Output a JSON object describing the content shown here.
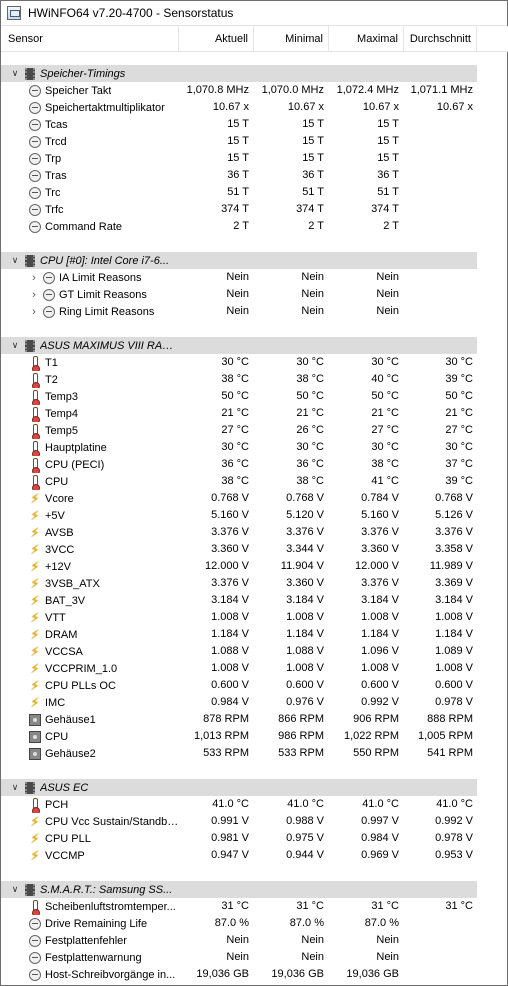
{
  "window": {
    "title": "HWiNFO64 v7.20-4700 - Sensorstatus"
  },
  "columns": {
    "sensor": "Sensor",
    "current": "Aktuell",
    "min": "Minimal",
    "max": "Maximal",
    "avg": "Durchschnitt"
  },
  "groups": [
    {
      "name": "Speicher-Timings",
      "rows": [
        {
          "icon": "clock",
          "label": "Speicher Takt",
          "cur": "1,070.8 MHz",
          "min": "1,070.0 MHz",
          "max": "1,072.4 MHz",
          "avg": "1,071.1 MHz"
        },
        {
          "icon": "clock",
          "label": "Speichertaktmultiplikator",
          "cur": "10.67 x",
          "min": "10.67 x",
          "max": "10.67 x",
          "avg": "10.67 x"
        },
        {
          "icon": "clock",
          "label": "Tcas",
          "cur": "15 T",
          "min": "15 T",
          "max": "15 T",
          "avg": ""
        },
        {
          "icon": "clock",
          "label": "Trcd",
          "cur": "15 T",
          "min": "15 T",
          "max": "15 T",
          "avg": ""
        },
        {
          "icon": "clock",
          "label": "Trp",
          "cur": "15 T",
          "min": "15 T",
          "max": "15 T",
          "avg": ""
        },
        {
          "icon": "clock",
          "label": "Tras",
          "cur": "36 T",
          "min": "36 T",
          "max": "36 T",
          "avg": ""
        },
        {
          "icon": "clock",
          "label": "Trc",
          "cur": "51 T",
          "min": "51 T",
          "max": "51 T",
          "avg": ""
        },
        {
          "icon": "clock",
          "label": "Trfc",
          "cur": "374 T",
          "min": "374 T",
          "max": "374 T",
          "avg": ""
        },
        {
          "icon": "clock",
          "label": "Command Rate",
          "cur": "2 T",
          "min": "2 T",
          "max": "2 T",
          "avg": ""
        }
      ]
    },
    {
      "name": "CPU [#0]: Intel Core i7-6...",
      "rows": [
        {
          "icon": "clock",
          "expandable": true,
          "label": "IA Limit Reasons",
          "cur": "Nein",
          "min": "Nein",
          "max": "Nein",
          "avg": ""
        },
        {
          "icon": "clock",
          "expandable": true,
          "label": "GT Limit Reasons",
          "cur": "Nein",
          "min": "Nein",
          "max": "Nein",
          "avg": ""
        },
        {
          "icon": "clock",
          "expandable": true,
          "label": "Ring Limit Reasons",
          "cur": "Nein",
          "min": "Nein",
          "max": "Nein",
          "avg": ""
        }
      ]
    },
    {
      "name": "ASUS MAXIMUS VIII RAN...",
      "rows": [
        {
          "icon": "therm",
          "label": "T1",
          "cur": "30 °C",
          "min": "30 °C",
          "max": "30 °C",
          "avg": "30 °C"
        },
        {
          "icon": "therm",
          "label": "T2",
          "cur": "38 °C",
          "min": "38 °C",
          "max": "40 °C",
          "avg": "39 °C"
        },
        {
          "icon": "therm",
          "label": "Temp3",
          "cur": "50 °C",
          "min": "50 °C",
          "max": "50 °C",
          "avg": "50 °C"
        },
        {
          "icon": "therm",
          "label": "Temp4",
          "cur": "21 °C",
          "min": "21 °C",
          "max": "21 °C",
          "avg": "21 °C"
        },
        {
          "icon": "therm",
          "label": "Temp5",
          "cur": "27 °C",
          "min": "26 °C",
          "max": "27 °C",
          "avg": "27 °C"
        },
        {
          "icon": "therm",
          "label": "Hauptplatine",
          "cur": "30 °C",
          "min": "30 °C",
          "max": "30 °C",
          "avg": "30 °C"
        },
        {
          "icon": "therm",
          "label": "CPU (PECI)",
          "cur": "36 °C",
          "min": "36 °C",
          "max": "38 °C",
          "avg": "37 °C"
        },
        {
          "icon": "therm",
          "label": "CPU",
          "cur": "38 °C",
          "min": "38 °C",
          "max": "41 °C",
          "avg": "39 °C"
        },
        {
          "icon": "volt",
          "label": "Vcore",
          "cur": "0.768 V",
          "min": "0.768 V",
          "max": "0.784 V",
          "avg": "0.768 V"
        },
        {
          "icon": "volt",
          "label": "+5V",
          "cur": "5.160 V",
          "min": "5.120 V",
          "max": "5.160 V",
          "avg": "5.126 V"
        },
        {
          "icon": "volt",
          "label": "AVSB",
          "cur": "3.376 V",
          "min": "3.376 V",
          "max": "3.376 V",
          "avg": "3.376 V"
        },
        {
          "icon": "volt",
          "label": "3VCC",
          "cur": "3.360 V",
          "min": "3.344 V",
          "max": "3.360 V",
          "avg": "3.358 V"
        },
        {
          "icon": "volt",
          "label": "+12V",
          "cur": "12.000 V",
          "min": "11.904 V",
          "max": "12.000 V",
          "avg": "11.989 V"
        },
        {
          "icon": "volt",
          "label": "3VSB_ATX",
          "cur": "3.376 V",
          "min": "3.360 V",
          "max": "3.376 V",
          "avg": "3.369 V"
        },
        {
          "icon": "volt",
          "label": "BAT_3V",
          "cur": "3.184 V",
          "min": "3.184 V",
          "max": "3.184 V",
          "avg": "3.184 V"
        },
        {
          "icon": "volt",
          "label": "VTT",
          "cur": "1.008 V",
          "min": "1.008 V",
          "max": "1.008 V",
          "avg": "1.008 V"
        },
        {
          "icon": "volt",
          "label": "DRAM",
          "cur": "1.184 V",
          "min": "1.184 V",
          "max": "1.184 V",
          "avg": "1.184 V"
        },
        {
          "icon": "volt",
          "label": "VCCSA",
          "cur": "1.088 V",
          "min": "1.088 V",
          "max": "1.096 V",
          "avg": "1.089 V"
        },
        {
          "icon": "volt",
          "label": "VCCPRIM_1.0",
          "cur": "1.008 V",
          "min": "1.008 V",
          "max": "1.008 V",
          "avg": "1.008 V"
        },
        {
          "icon": "volt",
          "label": "CPU PLLs OC",
          "cur": "0.600 V",
          "min": "0.600 V",
          "max": "0.600 V",
          "avg": "0.600 V"
        },
        {
          "icon": "volt",
          "label": "IMC",
          "cur": "0.984 V",
          "min": "0.976 V",
          "max": "0.992 V",
          "avg": "0.978 V"
        },
        {
          "icon": "fan",
          "label": "Gehäuse1",
          "cur": "878 RPM",
          "min": "866 RPM",
          "max": "906 RPM",
          "avg": "888 RPM"
        },
        {
          "icon": "fan",
          "label": "CPU",
          "cur": "1,013 RPM",
          "min": "986 RPM",
          "max": "1,022 RPM",
          "avg": "1,005 RPM"
        },
        {
          "icon": "fan",
          "label": "Gehäuse2",
          "cur": "533 RPM",
          "min": "533 RPM",
          "max": "550 RPM",
          "avg": "541 RPM"
        }
      ]
    },
    {
      "name": "ASUS EC",
      "rows": [
        {
          "icon": "therm",
          "label": "PCH",
          "cur": "41.0 °C",
          "min": "41.0 °C",
          "max": "41.0 °C",
          "avg": "41.0 °C"
        },
        {
          "icon": "volt",
          "label": "CPU Vcc Sustain/Standby...",
          "cur": "0.991 V",
          "min": "0.988 V",
          "max": "0.997 V",
          "avg": "0.992 V"
        },
        {
          "icon": "volt",
          "label": "CPU PLL",
          "cur": "0.981 V",
          "min": "0.975 V",
          "max": "0.984 V",
          "avg": "0.978 V"
        },
        {
          "icon": "volt",
          "label": "VCCMP",
          "cur": "0.947 V",
          "min": "0.944 V",
          "max": "0.969 V",
          "avg": "0.953 V"
        }
      ]
    },
    {
      "name": "S.M.A.R.T.: Samsung SS...",
      "rows": [
        {
          "icon": "therm",
          "label": "Scheibenluftstromtemper...",
          "cur": "31 °C",
          "min": "31 °C",
          "max": "31 °C",
          "avg": "31 °C"
        },
        {
          "icon": "clock",
          "label": "Drive Remaining Life",
          "cur": "87.0 %",
          "min": "87.0 %",
          "max": "87.0 %",
          "avg": ""
        },
        {
          "icon": "clock",
          "label": "Festplattenfehler",
          "cur": "Nein",
          "min": "Nein",
          "max": "Nein",
          "avg": ""
        },
        {
          "icon": "clock",
          "label": "Festplattenwarnung",
          "cur": "Nein",
          "min": "Nein",
          "max": "Nein",
          "avg": ""
        },
        {
          "icon": "clock",
          "label": "Host-Schreibvorgänge in...",
          "cur": "19,036 GB",
          "min": "19,036 GB",
          "max": "19,036 GB",
          "avg": ""
        }
      ]
    }
  ]
}
